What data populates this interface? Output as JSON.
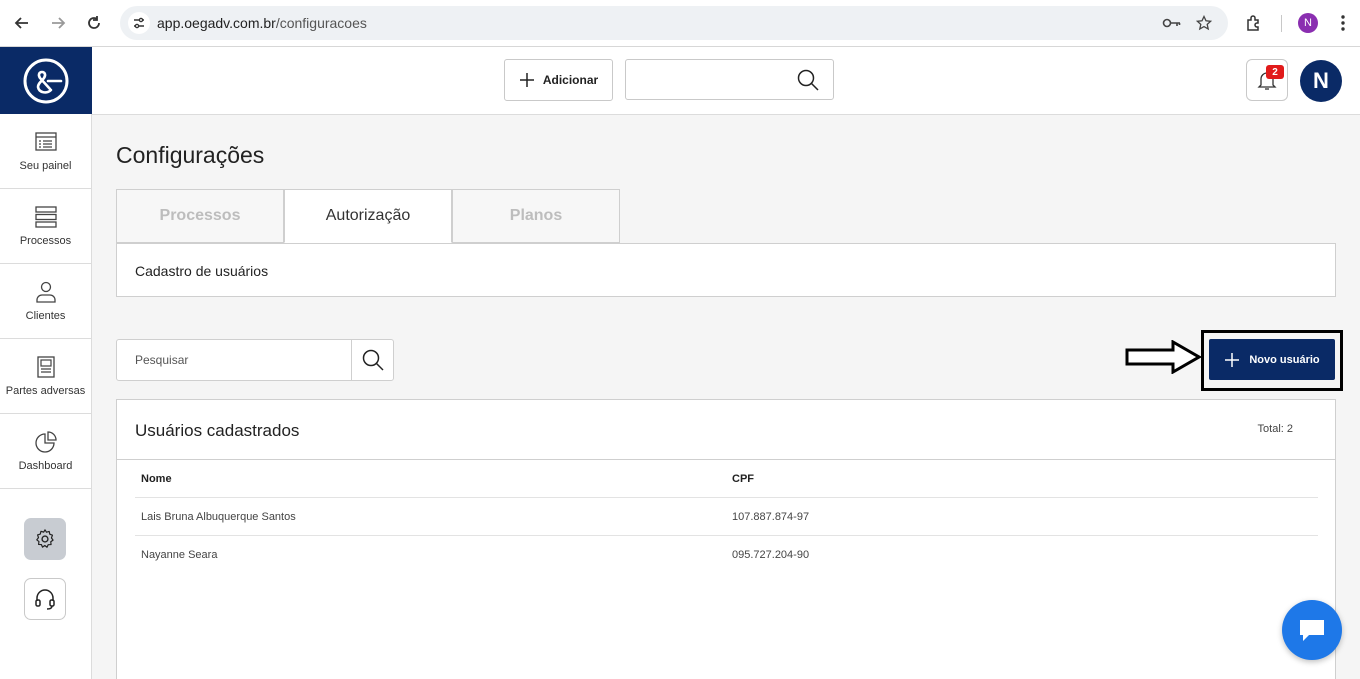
{
  "browser": {
    "url_host": "app.oegadv.com.br",
    "url_path": "/configuracoes",
    "profile_initial": "N"
  },
  "sidebar": {
    "items": [
      {
        "label": "Seu painel",
        "icon": "dashboard-list-icon"
      },
      {
        "label": "Processos",
        "icon": "stack-icon"
      },
      {
        "label": "Clientes",
        "icon": "person-icon"
      },
      {
        "label": "Partes adversas",
        "icon": "document-icon"
      },
      {
        "label": "Dashboard",
        "icon": "pie-chart-icon"
      }
    ],
    "settings_icon": "gear-icon",
    "support_icon": "headset-icon"
  },
  "topbar": {
    "add_label": "Adicionar",
    "notification_count": "2",
    "avatar_initial": "N"
  },
  "page": {
    "title": "Configurações",
    "tabs": [
      {
        "label": "Processos",
        "active": false
      },
      {
        "label": "Autorização",
        "active": true
      },
      {
        "label": "Planos",
        "active": false
      }
    ],
    "section_title": "Cadastro de usuários",
    "search_placeholder": "Pesquisar",
    "new_user_label": "Novo usuário"
  },
  "users": {
    "title": "Usuários cadastrados",
    "total": "Total: 2",
    "columns": [
      "Nome",
      "CPF"
    ],
    "rows": [
      {
        "name": "Lais Bruna Albuquerque Santos",
        "cpf": "107.887.874-97"
      },
      {
        "name": "Nayanne Seara",
        "cpf": "095.727.204-90"
      }
    ]
  },
  "colors": {
    "brand": "#0a2a66",
    "badge": "#e11b1b",
    "chat": "#1e78e8"
  }
}
